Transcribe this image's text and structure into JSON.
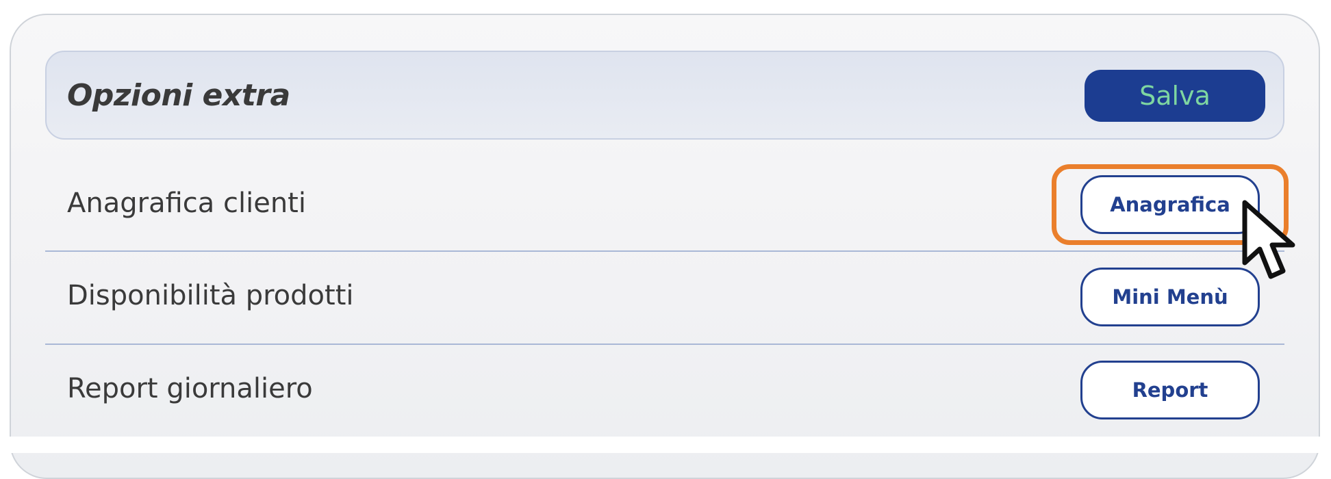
{
  "header": {
    "title": "Opzioni extra",
    "save_label": "Salva"
  },
  "rows": [
    {
      "label": "Anagrafica clienti",
      "button_label": "Anagrafica"
    },
    {
      "label": "Disponibilità prodotti",
      "button_label": "Mini Menù"
    },
    {
      "label": "Report giornaliero",
      "button_label": "Report"
    }
  ],
  "colors": {
    "accent": "#1c3d91",
    "save_text": "#7ed6a1",
    "highlight": "#ea7f2c",
    "divider": "#a9b8d6"
  },
  "icons": {
    "cursor": "mouse-pointer-icon"
  }
}
